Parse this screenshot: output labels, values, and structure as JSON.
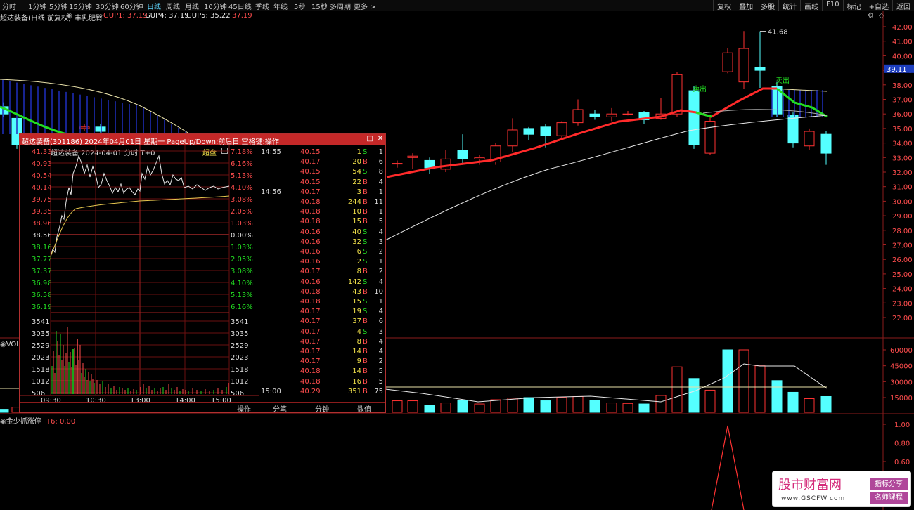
{
  "toolbar": {
    "timeframes": [
      "分时",
      "1分钟",
      "5分钟",
      "15分钟",
      "30分钟",
      "60分钟",
      "日线",
      "周线",
      "月线",
      "10分钟",
      "45日线",
      "季线",
      "年线",
      "5秒",
      "15秒",
      "多周期",
      "更多 >"
    ],
    "active": "日线",
    "right_buttons": [
      "复权",
      "叠加",
      "多股",
      "统计",
      "画线",
      "F10",
      "标记",
      "+自选",
      "返回"
    ]
  },
  "main": {
    "stock_title": "超达装备(日线 前复权)",
    "indicator_name": "丰乳肥臀",
    "gup1_label": "GUP1: 37.19",
    "gup4_label": "GUP4: 37.19",
    "gup5_label": "GUP5: 35.22",
    "extra_value": "37.19",
    "current_price": "39.11",
    "high_label": "41.68",
    "sell_labels": [
      "卖出",
      "卖出"
    ],
    "price_ticks": [
      "42.00",
      "41.00",
      "40.00",
      "39.00",
      "38.00",
      "37.00",
      "36.00",
      "35.00",
      "34.00",
      "33.00",
      "32.00",
      "31.00",
      "30.00",
      "29.00",
      "28.00",
      "27.00",
      "26.00",
      "25.00",
      "24.00",
      "23.00",
      "22.00"
    ],
    "vol_label": "VOLU",
    "vol_ticks": [
      "60000",
      "45000",
      "30000",
      "15000"
    ],
    "bottom_indicator": "金少抓涨停",
    "bottom_value": "T6: 0.00",
    "bottom_ticks": [
      "1.00",
      "0.80",
      "0.60"
    ]
  },
  "popup": {
    "title": "超达装备(301186)  2024年04月01日  星期一  PageUp/Down:前后日  空格键:操作",
    "subtitle": "超达装备  2024-04-01 分时 T+0",
    "overlay_label": "超盘",
    "price_ticks": [
      "41.33",
      "40.93",
      "40.54",
      "40.14",
      "39.75",
      "39.35",
      "38.96",
      "38.56",
      "38.16",
      "37.77",
      "37.37",
      "36.98",
      "36.58",
      "36.19"
    ],
    "pct_ticks": [
      "7.18%",
      "6.16%",
      "5.13%",
      "4.10%",
      "3.08%",
      "2.05%",
      "1.03%",
      "0.00%",
      "1.03%",
      "2.05%",
      "3.08%",
      "4.10%",
      "5.13%",
      "6.16%"
    ],
    "vol_ticks": [
      "3541",
      "3035",
      "2529",
      "2023",
      "1518",
      "1012",
      "506"
    ],
    "time_ticks": [
      "09:30",
      "10:30",
      "13:00",
      "14:00",
      "15:00"
    ],
    "ticks": [
      {
        "time": "14:55",
        "price": "40.15",
        "vol": "1",
        "side": "S",
        "count": "1"
      },
      {
        "time": "",
        "price": "40.17",
        "vol": "20",
        "side": "B",
        "count": "6"
      },
      {
        "time": "",
        "price": "40.15",
        "vol": "54",
        "side": "S",
        "count": "8"
      },
      {
        "time": "",
        "price": "40.15",
        "vol": "22",
        "side": "B",
        "count": "4"
      },
      {
        "time": "14:56",
        "price": "40.17",
        "vol": "3",
        "side": "B",
        "count": "1"
      },
      {
        "time": "",
        "price": "40.18",
        "vol": "244",
        "side": "B",
        "count": "11"
      },
      {
        "time": "",
        "price": "40.18",
        "vol": "10",
        "side": "B",
        "count": "1"
      },
      {
        "time": "",
        "price": "40.18",
        "vol": "15",
        "side": "B",
        "count": "5"
      },
      {
        "time": "",
        "price": "40.16",
        "vol": "40",
        "side": "S",
        "count": "4"
      },
      {
        "time": "",
        "price": "40.16",
        "vol": "32",
        "side": "S",
        "count": "3"
      },
      {
        "time": "",
        "price": "40.16",
        "vol": "6",
        "side": "S",
        "count": "2"
      },
      {
        "time": "",
        "price": "40.16",
        "vol": "2",
        "side": "S",
        "count": "1"
      },
      {
        "time": "",
        "price": "40.17",
        "vol": "8",
        "side": "B",
        "count": "2"
      },
      {
        "time": "",
        "price": "40.16",
        "vol": "142",
        "side": "S",
        "count": "4"
      },
      {
        "time": "",
        "price": "40.18",
        "vol": "43",
        "side": "B",
        "count": "10"
      },
      {
        "time": "",
        "price": "40.18",
        "vol": "15",
        "side": "S",
        "count": "1"
      },
      {
        "time": "",
        "price": "40.17",
        "vol": "19",
        "side": "S",
        "count": "4"
      },
      {
        "time": "",
        "price": "40.17",
        "vol": "37",
        "side": "B",
        "count": "6"
      },
      {
        "time": "",
        "price": "40.17",
        "vol": "4",
        "side": "S",
        "count": "3"
      },
      {
        "time": "",
        "price": "40.17",
        "vol": "8",
        "side": "B",
        "count": "4"
      },
      {
        "time": "",
        "price": "40.17",
        "vol": "14",
        "side": "B",
        "count": "4"
      },
      {
        "time": "",
        "price": "40.17",
        "vol": "9",
        "side": "B",
        "count": "2"
      },
      {
        "time": "",
        "price": "40.18",
        "vol": "14",
        "side": "B",
        "count": "5"
      },
      {
        "time": "",
        "price": "40.18",
        "vol": "16",
        "side": "B",
        "count": "5"
      },
      {
        "time": "15:00",
        "price": "40.29",
        "vol": "351",
        "side": "B",
        "count": "75"
      }
    ],
    "bottom_buttons": [
      "操作",
      "分笔",
      "分钟",
      "数值"
    ]
  },
  "watermark": {
    "name": "股市财富网",
    "url": "www.GSCFW.com",
    "tag1": "指标分享",
    "tag2": "名师课程"
  },
  "colors": {
    "up": "#ff3232",
    "down": "#54ffff",
    "ma_red": "#ff2a2a",
    "ma_green": "#22dd22",
    "ma_white": "#e8e8e8",
    "grid": "#7a0f0f"
  }
}
